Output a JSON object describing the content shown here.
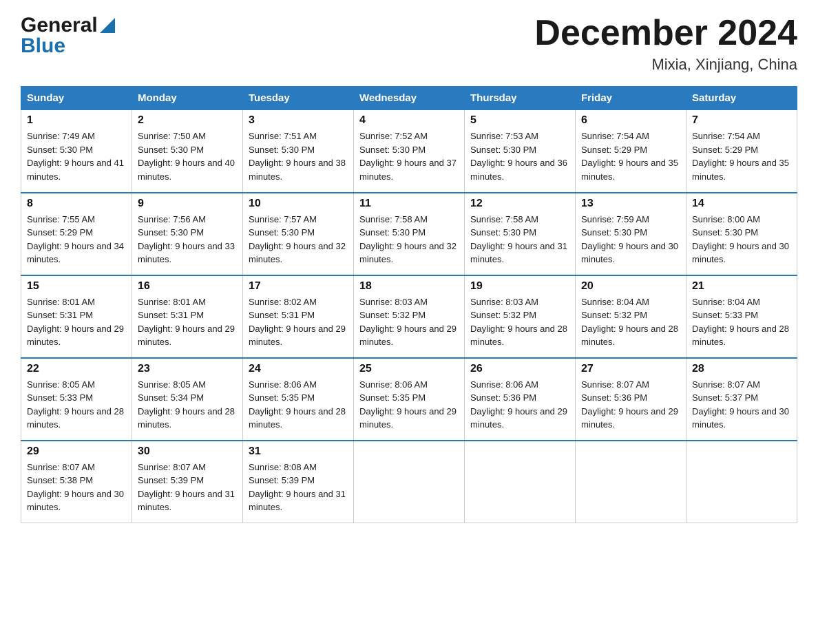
{
  "header": {
    "logo_general": "General",
    "logo_blue": "Blue",
    "title": "December 2024",
    "location": "Mixia, Xinjiang, China"
  },
  "calendar": {
    "days_of_week": [
      "Sunday",
      "Monday",
      "Tuesday",
      "Wednesday",
      "Thursday",
      "Friday",
      "Saturday"
    ],
    "weeks": [
      [
        {
          "day": "1",
          "sunrise": "7:49 AM",
          "sunset": "5:30 PM",
          "daylight": "9 hours and 41 minutes."
        },
        {
          "day": "2",
          "sunrise": "7:50 AM",
          "sunset": "5:30 PM",
          "daylight": "9 hours and 40 minutes."
        },
        {
          "day": "3",
          "sunrise": "7:51 AM",
          "sunset": "5:30 PM",
          "daylight": "9 hours and 38 minutes."
        },
        {
          "day": "4",
          "sunrise": "7:52 AM",
          "sunset": "5:30 PM",
          "daylight": "9 hours and 37 minutes."
        },
        {
          "day": "5",
          "sunrise": "7:53 AM",
          "sunset": "5:30 PM",
          "daylight": "9 hours and 36 minutes."
        },
        {
          "day": "6",
          "sunrise": "7:54 AM",
          "sunset": "5:29 PM",
          "daylight": "9 hours and 35 minutes."
        },
        {
          "day": "7",
          "sunrise": "7:54 AM",
          "sunset": "5:29 PM",
          "daylight": "9 hours and 35 minutes."
        }
      ],
      [
        {
          "day": "8",
          "sunrise": "7:55 AM",
          "sunset": "5:29 PM",
          "daylight": "9 hours and 34 minutes."
        },
        {
          "day": "9",
          "sunrise": "7:56 AM",
          "sunset": "5:30 PM",
          "daylight": "9 hours and 33 minutes."
        },
        {
          "day": "10",
          "sunrise": "7:57 AM",
          "sunset": "5:30 PM",
          "daylight": "9 hours and 32 minutes."
        },
        {
          "day": "11",
          "sunrise": "7:58 AM",
          "sunset": "5:30 PM",
          "daylight": "9 hours and 32 minutes."
        },
        {
          "day": "12",
          "sunrise": "7:58 AM",
          "sunset": "5:30 PM",
          "daylight": "9 hours and 31 minutes."
        },
        {
          "day": "13",
          "sunrise": "7:59 AM",
          "sunset": "5:30 PM",
          "daylight": "9 hours and 30 minutes."
        },
        {
          "day": "14",
          "sunrise": "8:00 AM",
          "sunset": "5:30 PM",
          "daylight": "9 hours and 30 minutes."
        }
      ],
      [
        {
          "day": "15",
          "sunrise": "8:01 AM",
          "sunset": "5:31 PM",
          "daylight": "9 hours and 29 minutes."
        },
        {
          "day": "16",
          "sunrise": "8:01 AM",
          "sunset": "5:31 PM",
          "daylight": "9 hours and 29 minutes."
        },
        {
          "day": "17",
          "sunrise": "8:02 AM",
          "sunset": "5:31 PM",
          "daylight": "9 hours and 29 minutes."
        },
        {
          "day": "18",
          "sunrise": "8:03 AM",
          "sunset": "5:32 PM",
          "daylight": "9 hours and 29 minutes."
        },
        {
          "day": "19",
          "sunrise": "8:03 AM",
          "sunset": "5:32 PM",
          "daylight": "9 hours and 28 minutes."
        },
        {
          "day": "20",
          "sunrise": "8:04 AM",
          "sunset": "5:32 PM",
          "daylight": "9 hours and 28 minutes."
        },
        {
          "day": "21",
          "sunrise": "8:04 AM",
          "sunset": "5:33 PM",
          "daylight": "9 hours and 28 minutes."
        }
      ],
      [
        {
          "day": "22",
          "sunrise": "8:05 AM",
          "sunset": "5:33 PM",
          "daylight": "9 hours and 28 minutes."
        },
        {
          "day": "23",
          "sunrise": "8:05 AM",
          "sunset": "5:34 PM",
          "daylight": "9 hours and 28 minutes."
        },
        {
          "day": "24",
          "sunrise": "8:06 AM",
          "sunset": "5:35 PM",
          "daylight": "9 hours and 28 minutes."
        },
        {
          "day": "25",
          "sunrise": "8:06 AM",
          "sunset": "5:35 PM",
          "daylight": "9 hours and 29 minutes."
        },
        {
          "day": "26",
          "sunrise": "8:06 AM",
          "sunset": "5:36 PM",
          "daylight": "9 hours and 29 minutes."
        },
        {
          "day": "27",
          "sunrise": "8:07 AM",
          "sunset": "5:36 PM",
          "daylight": "9 hours and 29 minutes."
        },
        {
          "day": "28",
          "sunrise": "8:07 AM",
          "sunset": "5:37 PM",
          "daylight": "9 hours and 30 minutes."
        }
      ],
      [
        {
          "day": "29",
          "sunrise": "8:07 AM",
          "sunset": "5:38 PM",
          "daylight": "9 hours and 30 minutes."
        },
        {
          "day": "30",
          "sunrise": "8:07 AM",
          "sunset": "5:39 PM",
          "daylight": "9 hours and 31 minutes."
        },
        {
          "day": "31",
          "sunrise": "8:08 AM",
          "sunset": "5:39 PM",
          "daylight": "9 hours and 31 minutes."
        },
        null,
        null,
        null,
        null
      ]
    ]
  },
  "labels": {
    "sunrise_prefix": "Sunrise: ",
    "sunset_prefix": "Sunset: ",
    "daylight_prefix": "Daylight: "
  }
}
